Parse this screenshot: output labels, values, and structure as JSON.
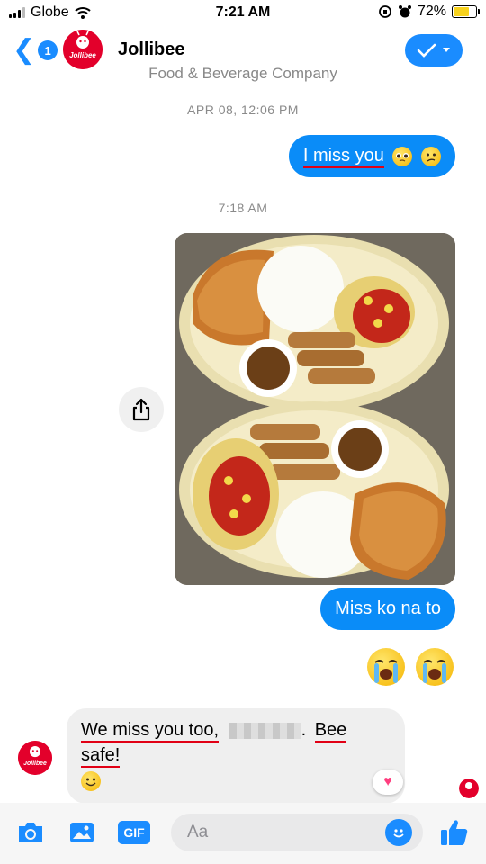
{
  "status_bar": {
    "carrier": "Globe",
    "time": "7:21 AM",
    "battery": "72%",
    "battery_level": 0.72
  },
  "header": {
    "unread_count": "1",
    "contact_name": "Jollibee",
    "avatar_text": "Jollibee",
    "subtitle": "Food & Beverage Company"
  },
  "conversation": {
    "timestamp_1": "APR 08, 12:06 PM",
    "outgoing_1": "I miss you",
    "timestamp_2": "7:18 AM",
    "outgoing_2": "Miss ko na to",
    "incoming_1_part1": "We miss you too,",
    "incoming_1_part2": ".",
    "incoming_1_part3": "Bee safe!",
    "reaction": "heart"
  },
  "composer": {
    "placeholder": "Aa",
    "gif_label": "GIF"
  },
  "colors": {
    "accent": "#1a8cff",
    "outgoing_bubble": "#0a8cf8",
    "brand_red": "#e3002b",
    "annotation_red": "#e10015"
  },
  "icons": [
    "back-chevron-icon",
    "checkmark-icon",
    "dropdown-icon",
    "share-icon",
    "camera-icon",
    "photo-icon",
    "gif-icon",
    "emoji-icon",
    "thumbs-up-icon",
    "heart-icon"
  ]
}
